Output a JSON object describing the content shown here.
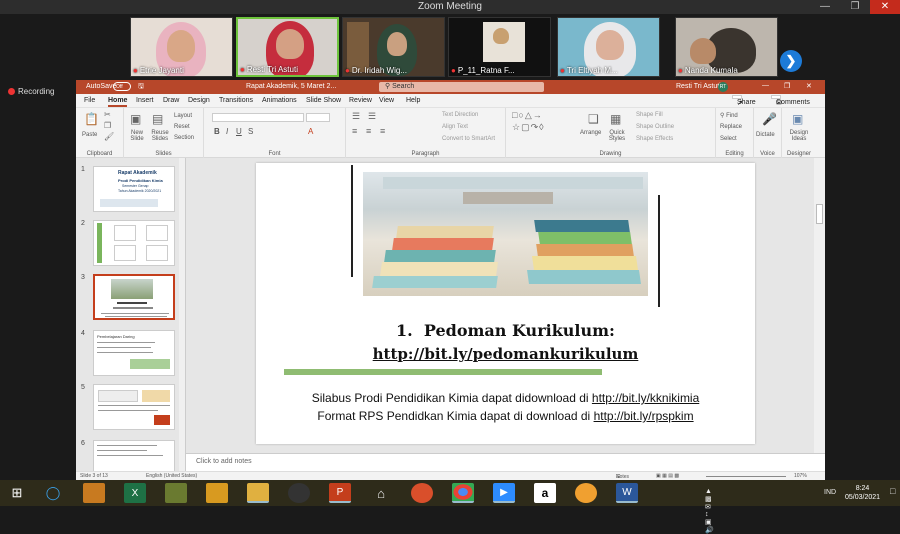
{
  "zoom": {
    "title": "Zoom Meeting",
    "recording": "Recording"
  },
  "participants": [
    {
      "name": "Etrie Jayanti"
    },
    {
      "name": "Resti Tri Astuti"
    },
    {
      "name": "Dr. Iridah Wig..."
    },
    {
      "name": "P_11_Ratna F..."
    },
    {
      "name": "Tri Eltiyah M..."
    },
    {
      "name": "Nanda Kumala"
    }
  ],
  "ppt": {
    "autosave": "AutoSave",
    "autosave_state": "Off",
    "doc": "Rapat Akademik, 5 Maret 2...",
    "search": "Search",
    "user": "Resti Tri Astuti",
    "avatar": "RT",
    "tabs": [
      "File",
      "Home",
      "Insert",
      "Draw",
      "Design",
      "Transitions",
      "Animations",
      "Slide Show",
      "Review",
      "View",
      "Help"
    ],
    "share": "Share",
    "comments": "Comments",
    "ribbon": {
      "groups": [
        "Clipboard",
        "Slides",
        "Font",
        "Paragraph",
        "Drawing",
        "Editing",
        "Voice",
        "Designer"
      ],
      "paste": "Paste",
      "new_slide": "New Slide",
      "reuse": "Reuse Slides",
      "layout": "Layout",
      "reset": "Reset",
      "section": "Section",
      "text_dir": "Text Direction",
      "align_text": "Align Text",
      "smartart": "Convert to SmartArt",
      "arrange": "Arrange",
      "quick_styles": "Quick Styles",
      "shape_fill": "Shape Fill",
      "shape_outline": "Shape Outline",
      "shape_effects": "Shape Effects",
      "find": "Find",
      "replace": "Replace",
      "select": "Select",
      "dictate": "Dictate",
      "design_ideas": "Design Ideas"
    },
    "thumbs": [
      {
        "n": "1",
        "title": "Rapat Akademik",
        "sub": "Prodi Pendidikan Kimia",
        "sub2": "Semester Genap",
        "sub3": "Tahun Akademik 2020/2021"
      },
      {
        "n": "2"
      },
      {
        "n": "3"
      },
      {
        "n": "4",
        "title": "Pembelajaran Daring"
      },
      {
        "n": "5"
      },
      {
        "n": "6"
      }
    ],
    "slide": {
      "heading_num": "1.",
      "heading": "Pedoman Kurikulum:",
      "link": "http://bit.ly/pedomankurikulum",
      "line1_pre": "Silabus Prodi Pendidikan Kimia dapat didownload di ",
      "line1_link": "http://bit.ly/kknikimia",
      "line2_pre": "Format RPS Pendidkan Kimia dapat di download di ",
      "line2_link": "http://bit.ly/rpspkim"
    },
    "notes": "Click to add notes",
    "status": {
      "slide": "Slide 3 of 13",
      "lang": "English (United States)",
      "notes": "Notes",
      "zoom": "107%"
    }
  },
  "taskbar": {
    "lang": "IND",
    "time": "8:24",
    "date": "05/03/2021"
  }
}
